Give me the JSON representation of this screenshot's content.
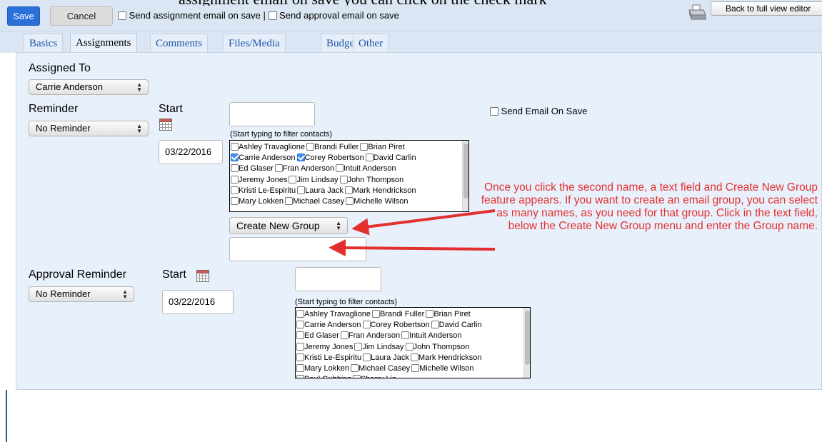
{
  "banner_clipped_text": "assignment email on save you can click on the check mark",
  "toolbar": {
    "save_label": "Save",
    "cancel_label": "Cancel",
    "opt_assignment_email": "Send assignment email on save |",
    "opt_approval_email": "Send approval email on save",
    "back_label": "Back to full view editor",
    "printer_icon": "printer-icon"
  },
  "tabs": [
    {
      "label": "Basics",
      "active": false
    },
    {
      "label": "Assignments",
      "active": true
    },
    {
      "label": "Comments",
      "active": false
    },
    {
      "label": "Files/Media",
      "active": false
    },
    {
      "label": "Budget",
      "active": false
    },
    {
      "label": "Other",
      "active": false
    }
  ],
  "assigned_to": {
    "label": "Assigned To",
    "value": "Carrie Anderson"
  },
  "reminder": {
    "label": "Reminder",
    "value": "No Reminder",
    "start_label": "Start",
    "date": "03/22/2016",
    "filter_hint": "(Start typing to filter contacts)",
    "send_email_label": "Send Email On Save",
    "contacts": [
      [
        {
          "name": "Ashley Travaglione",
          "checked": false
        },
        {
          "name": "Brandi Fuller",
          "checked": false
        },
        {
          "name": "Brian Piret",
          "checked": false
        }
      ],
      [
        {
          "name": "Carrie Anderson",
          "checked": true
        },
        {
          "name": "Corey Robertson",
          "checked": true
        },
        {
          "name": "David Carlin",
          "checked": false
        }
      ],
      [
        {
          "name": "Ed Glaser",
          "checked": false
        },
        {
          "name": "Fran Anderson",
          "checked": false
        },
        {
          "name": "Intuit Anderson",
          "checked": false
        }
      ],
      [
        {
          "name": "Jeremy Jones",
          "checked": false
        },
        {
          "name": "Jim Lindsay",
          "checked": false
        },
        {
          "name": "John Thompson",
          "checked": false
        }
      ],
      [
        {
          "name": "Kristi Le-Espiritu",
          "checked": false
        },
        {
          "name": "Laura Jack",
          "checked": false
        },
        {
          "name": "Mark Hendrickson",
          "checked": false
        }
      ],
      [
        {
          "name": "Mary Lokken",
          "checked": false
        },
        {
          "name": "Michael Casey",
          "checked": false
        },
        {
          "name": "Michelle Wilson",
          "checked": false
        }
      ]
    ],
    "group_select": "Create New Group"
  },
  "approval": {
    "label": "Approval Reminder",
    "value": "No Reminder",
    "start_label": "Start",
    "date": "03/22/2016",
    "filter_hint": "(Start typing to filter contacts)",
    "contacts": [
      [
        {
          "name": "Ashley Travaglione",
          "checked": false
        },
        {
          "name": "Brandi Fuller",
          "checked": false
        },
        {
          "name": "Brian Piret",
          "checked": false
        }
      ],
      [
        {
          "name": "Carrie Anderson",
          "checked": false
        },
        {
          "name": "Corey Robertson",
          "checked": false
        },
        {
          "name": "David Carlin",
          "checked": false
        }
      ],
      [
        {
          "name": "Ed Glaser",
          "checked": false
        },
        {
          "name": "Fran Anderson",
          "checked": false
        },
        {
          "name": "Intuit Anderson",
          "checked": false
        }
      ],
      [
        {
          "name": "Jeremy Jones",
          "checked": false
        },
        {
          "name": "Jim Lindsay",
          "checked": false
        },
        {
          "name": "John Thompson",
          "checked": false
        }
      ],
      [
        {
          "name": "Kristi Le-Espiritu",
          "checked": false
        },
        {
          "name": "Laura Jack",
          "checked": false
        },
        {
          "name": "Mark Hendrickson",
          "checked": false
        }
      ],
      [
        {
          "name": "Mary Lokken",
          "checked": false
        },
        {
          "name": "Michael Casey",
          "checked": false
        },
        {
          "name": "Michelle Wilson",
          "checked": false
        }
      ],
      [
        {
          "name": "Paul Gubbins",
          "checked": false
        },
        {
          "name": "Sherry Lin",
          "checked": false
        }
      ]
    ]
  },
  "annotation": {
    "text": "Once you click the second name, a text field and Create New Group feature appears.  If you want to create an email group, you can select as many names, as you need for that group.  Click in the text field, below the Create New Group menu and enter the Group name.",
    "color": "#e3302f"
  }
}
